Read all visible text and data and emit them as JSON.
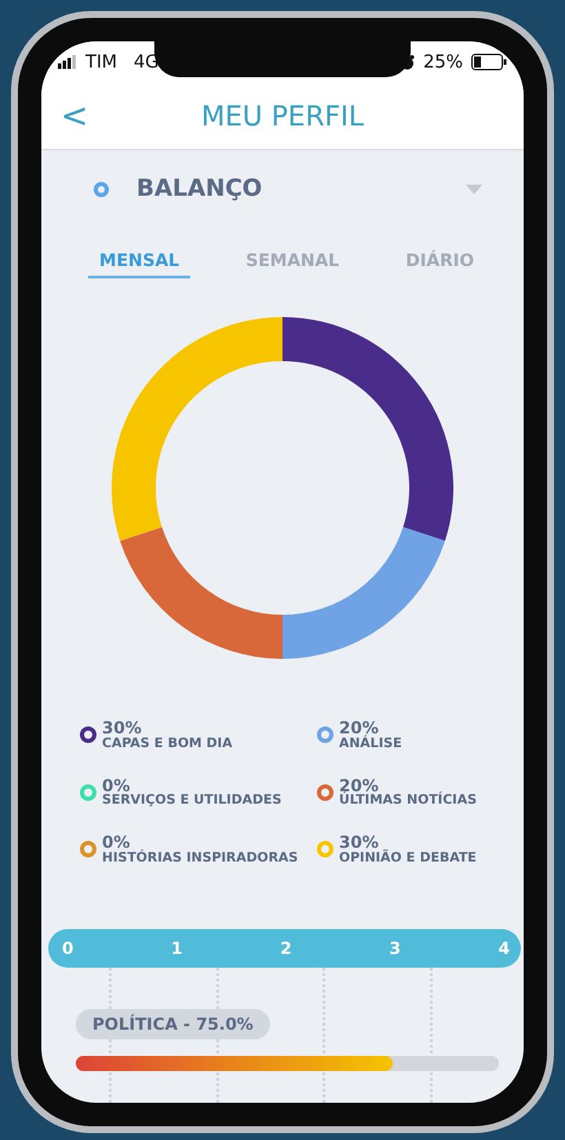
{
  "status_bar": {
    "carrier": "TIM",
    "network": "4G",
    "battery": "25%"
  },
  "header": {
    "back": "<",
    "title": "MEU PERFIL"
  },
  "section": {
    "title": "BALANÇO"
  },
  "tabs": [
    {
      "label": "MENSAL",
      "selected": true
    },
    {
      "label": "SEMANAL",
      "selected": false
    },
    {
      "label": "DIÁRIO",
      "selected": false
    }
  ],
  "chart_data": {
    "type": "donut",
    "categories": [
      "CAPAS E BOM DIA",
      "ANÁLISE",
      "SERVIÇOS E UTILIDADES",
      "ÚLTIMAS NOTÍCIAS",
      "HISTÓRIAS INSPIRADORAS",
      "OPINIÃO E DEBATE"
    ],
    "values": [
      30,
      20,
      0,
      20,
      0,
      30
    ]
  },
  "legend": [
    {
      "percent": "30%",
      "color": "#4a2c8a"
    },
    {
      "percent": "20%",
      "color": "#6fa3e6"
    },
    {
      "percent": "0%",
      "color": "#3ddfa8"
    },
    {
      "percent": "20%",
      "color": "#d8683a"
    },
    {
      "percent": "0%",
      "color": "#dc9428"
    },
    {
      "percent": "30%",
      "color": "#f7c500"
    }
  ],
  "scale": {
    "ticks": [
      "0",
      "1",
      "2",
      "3",
      "4"
    ]
  },
  "topics": [
    {
      "label": "POLÍTICA - 75.0%",
      "level": 0.75
    }
  ]
}
